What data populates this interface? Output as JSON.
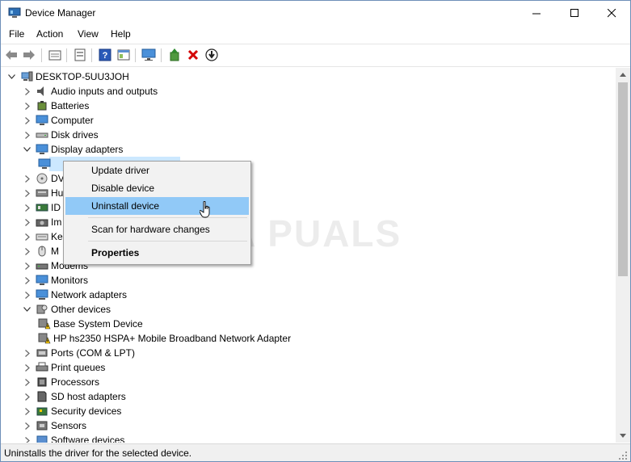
{
  "window": {
    "title": "Device Manager",
    "title_icon": "device-manager-icon"
  },
  "menu": [
    "File",
    "Action",
    "View",
    "Help"
  ],
  "toolbar": {
    "buttons": [
      "back-arrow-icon",
      "forward-arrow-icon",
      "properties-icon",
      "show-hide-icon",
      "help-icon",
      "view-icon",
      "monitor-icon",
      "update-driver-icon",
      "uninstall-icon",
      "download-icon"
    ]
  },
  "tree": {
    "root": "DESKTOP-5UU3JOH",
    "items": [
      {
        "label": "Audio inputs and outputs",
        "expanded": false,
        "icon": "speaker-icon"
      },
      {
        "label": "Batteries",
        "expanded": false,
        "icon": "battery-icon"
      },
      {
        "label": "Computer",
        "expanded": false,
        "icon": "computer-icon"
      },
      {
        "label": "Disk drives",
        "expanded": false,
        "icon": "disk-drive-icon"
      },
      {
        "label": "Display adapters",
        "expanded": true,
        "icon": "display-adapter-icon"
      },
      {
        "label": "DV",
        "expanded": false,
        "icon": "dvd-icon"
      },
      {
        "label": "Hu",
        "expanded": false,
        "icon": "hid-icon"
      },
      {
        "label": "ID",
        "expanded": false,
        "icon": "ide-icon"
      },
      {
        "label": "Im",
        "expanded": false,
        "icon": "camera-icon"
      },
      {
        "label": "Ke",
        "expanded": false,
        "icon": "keyboard-icon"
      },
      {
        "label": "M",
        "expanded": false,
        "icon": "mouse-icon"
      },
      {
        "label": "Modems",
        "expanded": false,
        "icon": "modem-icon"
      },
      {
        "label": "Monitors",
        "expanded": false,
        "icon": "monitor-icon"
      },
      {
        "label": "Network adapters",
        "expanded": false,
        "icon": "network-icon"
      },
      {
        "label": "Other devices",
        "expanded": true,
        "icon": "other-devices-icon"
      },
      {
        "label": "Base System Device",
        "child": true,
        "icon": "warning-device-icon"
      },
      {
        "label": "HP hs2350 HSPA+ Mobile Broadband Network Adapter",
        "child": true,
        "icon": "warning-device-icon"
      },
      {
        "label": "Ports (COM & LPT)",
        "expanded": false,
        "icon": "port-icon"
      },
      {
        "label": "Print queues",
        "expanded": false,
        "icon": "printer-icon"
      },
      {
        "label": "Processors",
        "expanded": false,
        "icon": "processor-icon"
      },
      {
        "label": "SD host adapters",
        "expanded": false,
        "icon": "sd-card-icon"
      },
      {
        "label": "Security devices",
        "expanded": false,
        "icon": "security-icon"
      },
      {
        "label": "Sensors",
        "expanded": false,
        "icon": "sensor-icon"
      },
      {
        "label": "Software devices",
        "expanded": false,
        "icon": "software-icon"
      }
    ]
  },
  "context_menu": {
    "items": [
      "Update driver",
      "Disable device",
      "Uninstall device",
      "Scan for hardware changes",
      "Properties"
    ],
    "highlighted": "Uninstall device"
  },
  "watermark": "A PUALS",
  "status": "Uninstalls the driver for the selected device.",
  "colors": {
    "selection": "#cce8ff",
    "menu_highlight": "#91c9f7",
    "uninstall_red": "#d40000"
  }
}
